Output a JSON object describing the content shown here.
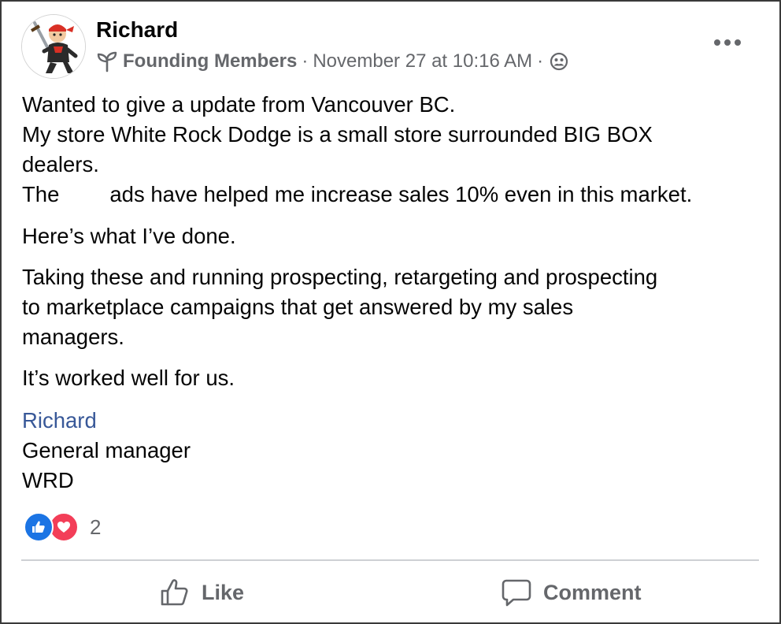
{
  "post": {
    "author": "Richard",
    "group": "Founding Members",
    "separator": "·",
    "timestamp": "November 27 at 10:16 AM",
    "body": {
      "line1": "Wanted to give a update from Vancouver BC.",
      "line2": "My store White Rock Dodge is a small store surrounded BIG BOX",
      "line3": "dealers.",
      "line4_start": "The",
      "line4_end": "ads have helped me increase sales 10% even in this market.",
      "para2": "Here’s what I’ve done.",
      "para3_line1": "Taking these and running prospecting, retargeting and prospecting",
      "para3_line2": "to marketplace  campaigns that get answered by my sales",
      "para3_line3": "managers.",
      "para4": "It’s worked well for us."
    },
    "signature": {
      "name": "Richard",
      "title": "General manager",
      "company": "WRD"
    },
    "reactions": {
      "types": [
        "like",
        "love"
      ],
      "count": "2"
    },
    "actions": {
      "like_label": "Like",
      "comment_label": "Comment"
    }
  },
  "icons": {
    "group": "sprout-icon",
    "audience": "members-globe-icon",
    "more": "more-horizontal-icon",
    "like": "thumbs-up-icon",
    "comment": "speech-bubble-icon"
  },
  "colors": {
    "text_primary": "#050505",
    "text_secondary": "#65676b",
    "link": "#385898",
    "like_blue": "#1b74e4",
    "love_red": "#f33e58",
    "divider": "#ced0d4"
  }
}
